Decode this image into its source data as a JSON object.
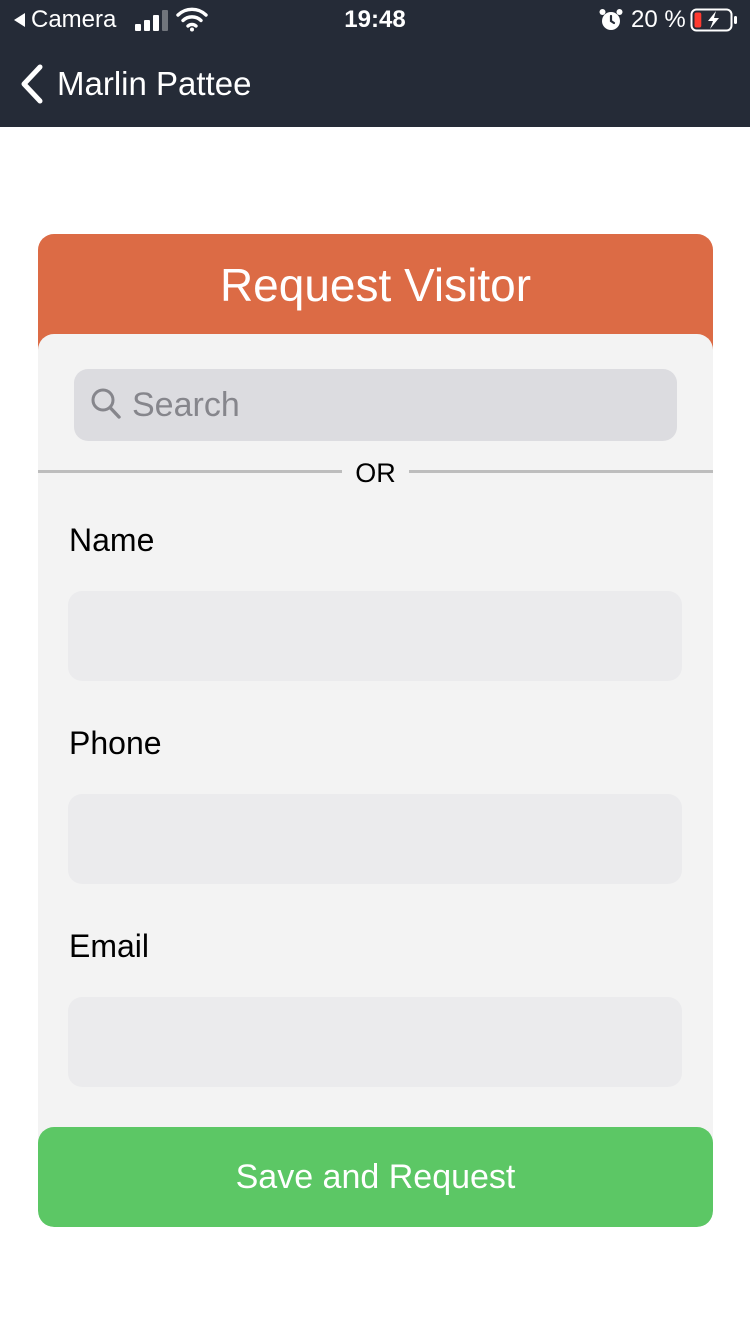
{
  "status_bar": {
    "back_app": "Camera",
    "time": "19:48",
    "battery_percent": "20 %",
    "battery_level": 0.2,
    "icons": [
      "signal-icon",
      "wifi-icon",
      "alarm-icon",
      "battery-charging-icon"
    ]
  },
  "nav": {
    "back_icon": "chevron-left-icon",
    "title": "Marlin Pattee"
  },
  "card": {
    "title": "Request Visitor",
    "search": {
      "placeholder": "Search",
      "value": "",
      "icon": "search-icon"
    },
    "divider_text": "OR",
    "fields": {
      "name": {
        "label": "Name",
        "value": ""
      },
      "phone": {
        "label": "Phone",
        "value": ""
      },
      "email": {
        "label": "Email",
        "value": ""
      }
    },
    "submit_label": "Save and Request"
  },
  "colors": {
    "nav_bg": "#252b37",
    "header_accent": "#dc6b45",
    "button_green": "#5cc765",
    "card_bg": "#f3f3f3",
    "input_bg": "#ebebed",
    "search_bg": "#dcdce0"
  }
}
